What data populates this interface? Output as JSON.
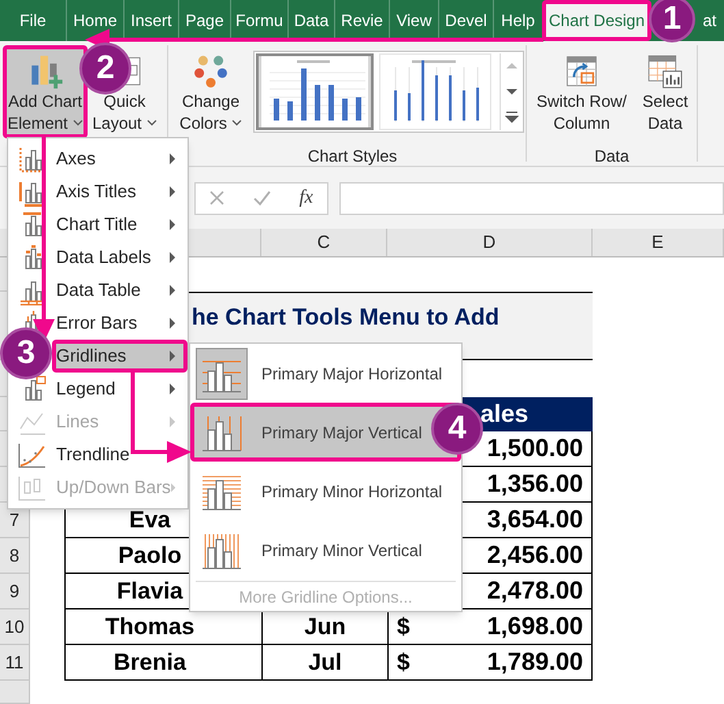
{
  "ribbon_tabs": [
    {
      "label": "File",
      "selected": false
    },
    {
      "label": "Home",
      "selected": false
    },
    {
      "label": "Insert",
      "selected": false
    },
    {
      "label": "Page",
      "selected": false
    },
    {
      "label": "Formu",
      "selected": false
    },
    {
      "label": "Data",
      "selected": false
    },
    {
      "label": "Revie",
      "selected": false
    },
    {
      "label": "View",
      "selected": false
    },
    {
      "label": "Devel",
      "selected": false
    },
    {
      "label": "Help",
      "selected": false
    },
    {
      "label": "Chart Design",
      "selected": true
    },
    {
      "label": "at",
      "selected": false
    }
  ],
  "ribbon": {
    "buttons": [
      {
        "kind": "add-chart-element",
        "lines": [
          "Add Chart",
          "Element"
        ],
        "dropdown": true,
        "pressed": true
      },
      {
        "kind": "quick-layout",
        "lines": [
          "Quick",
          "Layout"
        ],
        "dropdown": true,
        "pressed": false
      },
      {
        "kind": "change-colors",
        "lines": [
          "Change",
          "Colors"
        ],
        "dropdown": true,
        "pressed": false
      },
      {
        "kind": "switch-row-column",
        "lines": [
          "Switch Row/",
          "Column"
        ],
        "dropdown": false,
        "pressed": false
      },
      {
        "kind": "select-data",
        "lines": [
          "Select",
          "Data"
        ],
        "dropdown": false,
        "pressed": false
      }
    ],
    "chart_styles": [
      {
        "selected": true
      },
      {
        "selected": false
      }
    ],
    "group_labels": [
      "Chart Styles",
      "Data"
    ]
  },
  "formula_bar": {
    "function_label": "fx"
  },
  "column_headers": [
    "C",
    "D",
    "E"
  ],
  "row_headers": [
    "7",
    "8",
    "9",
    "10",
    "11"
  ],
  "sheet": {
    "title": "he Chart Tools Menu to Add",
    "sales_header": "ales",
    "rows": [
      {
        "amount": "1,500.00"
      },
      {
        "amount": "1,356.00"
      },
      {
        "name": "Eva",
        "amount": "3,654.00"
      },
      {
        "name": "Paolo",
        "amount": "2,456.00"
      },
      {
        "name": "Flavia",
        "amount": "2,478.00"
      },
      {
        "name": "Thomas",
        "month": "Jun",
        "currency": "$",
        "amount": "1,698.00"
      },
      {
        "name": "Brenia",
        "month": "Jul",
        "currency": "$",
        "amount": "1,789.00"
      }
    ]
  },
  "chart_element_menu": [
    {
      "label": "Axes",
      "disabled": false,
      "selected": false
    },
    {
      "label": "Axis Titles",
      "disabled": false,
      "selected": false
    },
    {
      "label": "Chart Title",
      "disabled": false,
      "selected": false
    },
    {
      "label": "Data Labels",
      "disabled": false,
      "selected": false
    },
    {
      "label": "Data Table",
      "disabled": false,
      "selected": false
    },
    {
      "label": "Error Bars",
      "disabled": false,
      "selected": false
    },
    {
      "label": "Gridlines",
      "disabled": false,
      "selected": true
    },
    {
      "label": "Legend",
      "disabled": false,
      "selected": false
    },
    {
      "label": "Lines",
      "disabled": true,
      "selected": false
    },
    {
      "label": "Trendline",
      "disabled": false,
      "selected": false
    },
    {
      "label": "Up/Down Bars",
      "disabled": true,
      "selected": false
    }
  ],
  "gridlines_submenu": {
    "items": [
      {
        "label": "Primary Major Horizontal",
        "checked": true,
        "selected": false
      },
      {
        "label": "Primary Major Vertical",
        "checked": false,
        "selected": true
      },
      {
        "label": "Primary Minor Horizontal",
        "checked": false,
        "selected": false
      },
      {
        "label": "Primary Minor Vertical",
        "checked": false,
        "selected": false
      }
    ],
    "more_options": {
      "label": "More Gridline Options...",
      "disabled": true
    }
  },
  "step_badges": [
    "1",
    "2",
    "3",
    "4"
  ]
}
